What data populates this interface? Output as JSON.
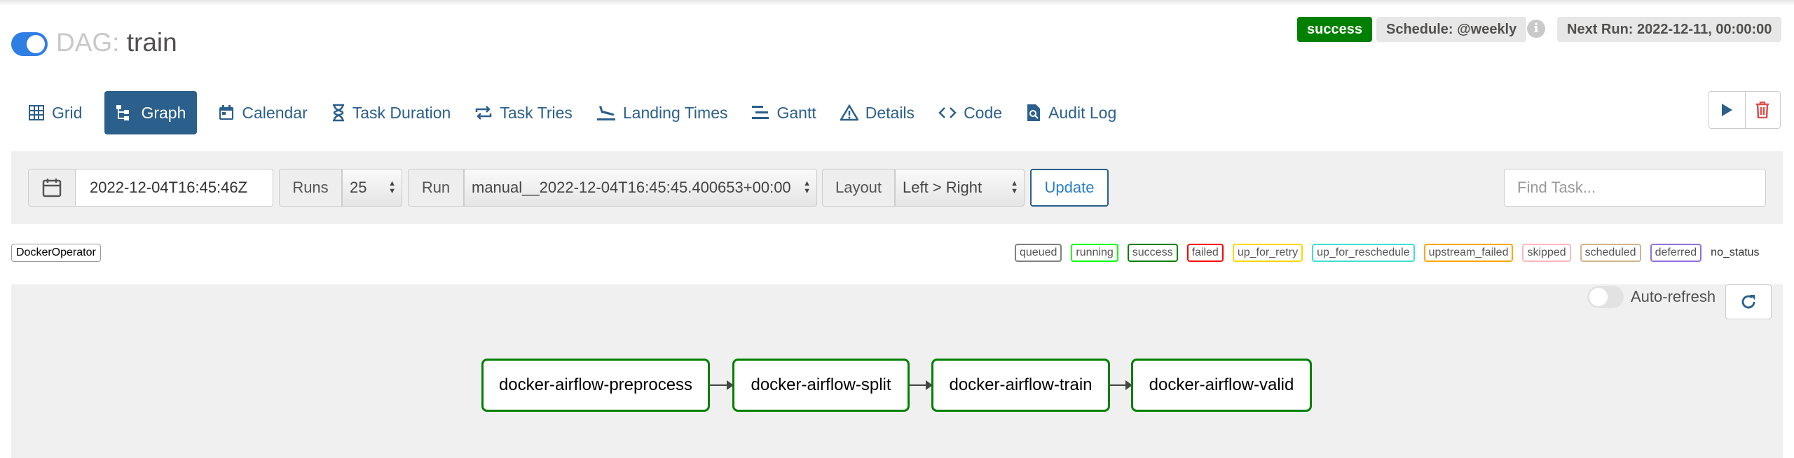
{
  "header": {
    "dag_prefix": "DAG:",
    "dag_name": "train",
    "state": "success",
    "schedule": "Schedule: @weekly",
    "info": "i",
    "next_run": "Next Run: 2022-12-11, 00:00:00",
    "colors": {
      "success": "#008000",
      "tab_active": "#2b5f8c",
      "toggle_on": "#2f7ee3"
    }
  },
  "nav": {
    "tabs": [
      {
        "label": "Grid",
        "icon": "grid-icon"
      },
      {
        "label": "Graph",
        "icon": "graph-icon",
        "active": true
      },
      {
        "label": "Calendar",
        "icon": "calendar-icon"
      },
      {
        "label": "Task Duration",
        "icon": "hourglass-icon"
      },
      {
        "label": "Task Tries",
        "icon": "retry-icon"
      },
      {
        "label": "Landing Times",
        "icon": "landing-icon"
      },
      {
        "label": "Gantt",
        "icon": "gantt-icon"
      },
      {
        "label": "Details",
        "icon": "warning-triangle-icon"
      },
      {
        "label": "Code",
        "icon": "code-icon"
      },
      {
        "label": "Audit Log",
        "icon": "audit-log-icon"
      }
    ],
    "actions": [
      "play-icon",
      "trash-icon"
    ]
  },
  "toolbar": {
    "base_date": "2022-12-04T16:45:46Z",
    "runs_label": "Runs",
    "runs_value": "25",
    "run_label": "Run",
    "run_value": "manual__2022-12-04T16:45:45.400653+00:00",
    "layout_label": "Layout",
    "layout_value": "Left > Right",
    "update_label": "Update",
    "find_placeholder": "Find Task..."
  },
  "legend": {
    "operator": "DockerOperator",
    "states": [
      {
        "label": "queued",
        "color": "#808080"
      },
      {
        "label": "running",
        "color": "#00ff00"
      },
      {
        "label": "success",
        "color": "#008000"
      },
      {
        "label": "failed",
        "color": "#ff0000"
      },
      {
        "label": "up_for_retry",
        "color": "#ffd700"
      },
      {
        "label": "up_for_reschedule",
        "color": "#40e0d0"
      },
      {
        "label": "upstream_failed",
        "color": "#ffa500"
      },
      {
        "label": "skipped",
        "color": "#ffb6c1"
      },
      {
        "label": "scheduled",
        "color": "#d2b48c"
      },
      {
        "label": "deferred",
        "color": "#9370db"
      }
    ],
    "no_status": "no_status"
  },
  "graph": {
    "auto_refresh_label": "Auto-refresh",
    "nodes": [
      "docker-airflow-preprocess",
      "docker-airflow-split",
      "docker-airflow-train",
      "docker-airflow-valid"
    ]
  }
}
